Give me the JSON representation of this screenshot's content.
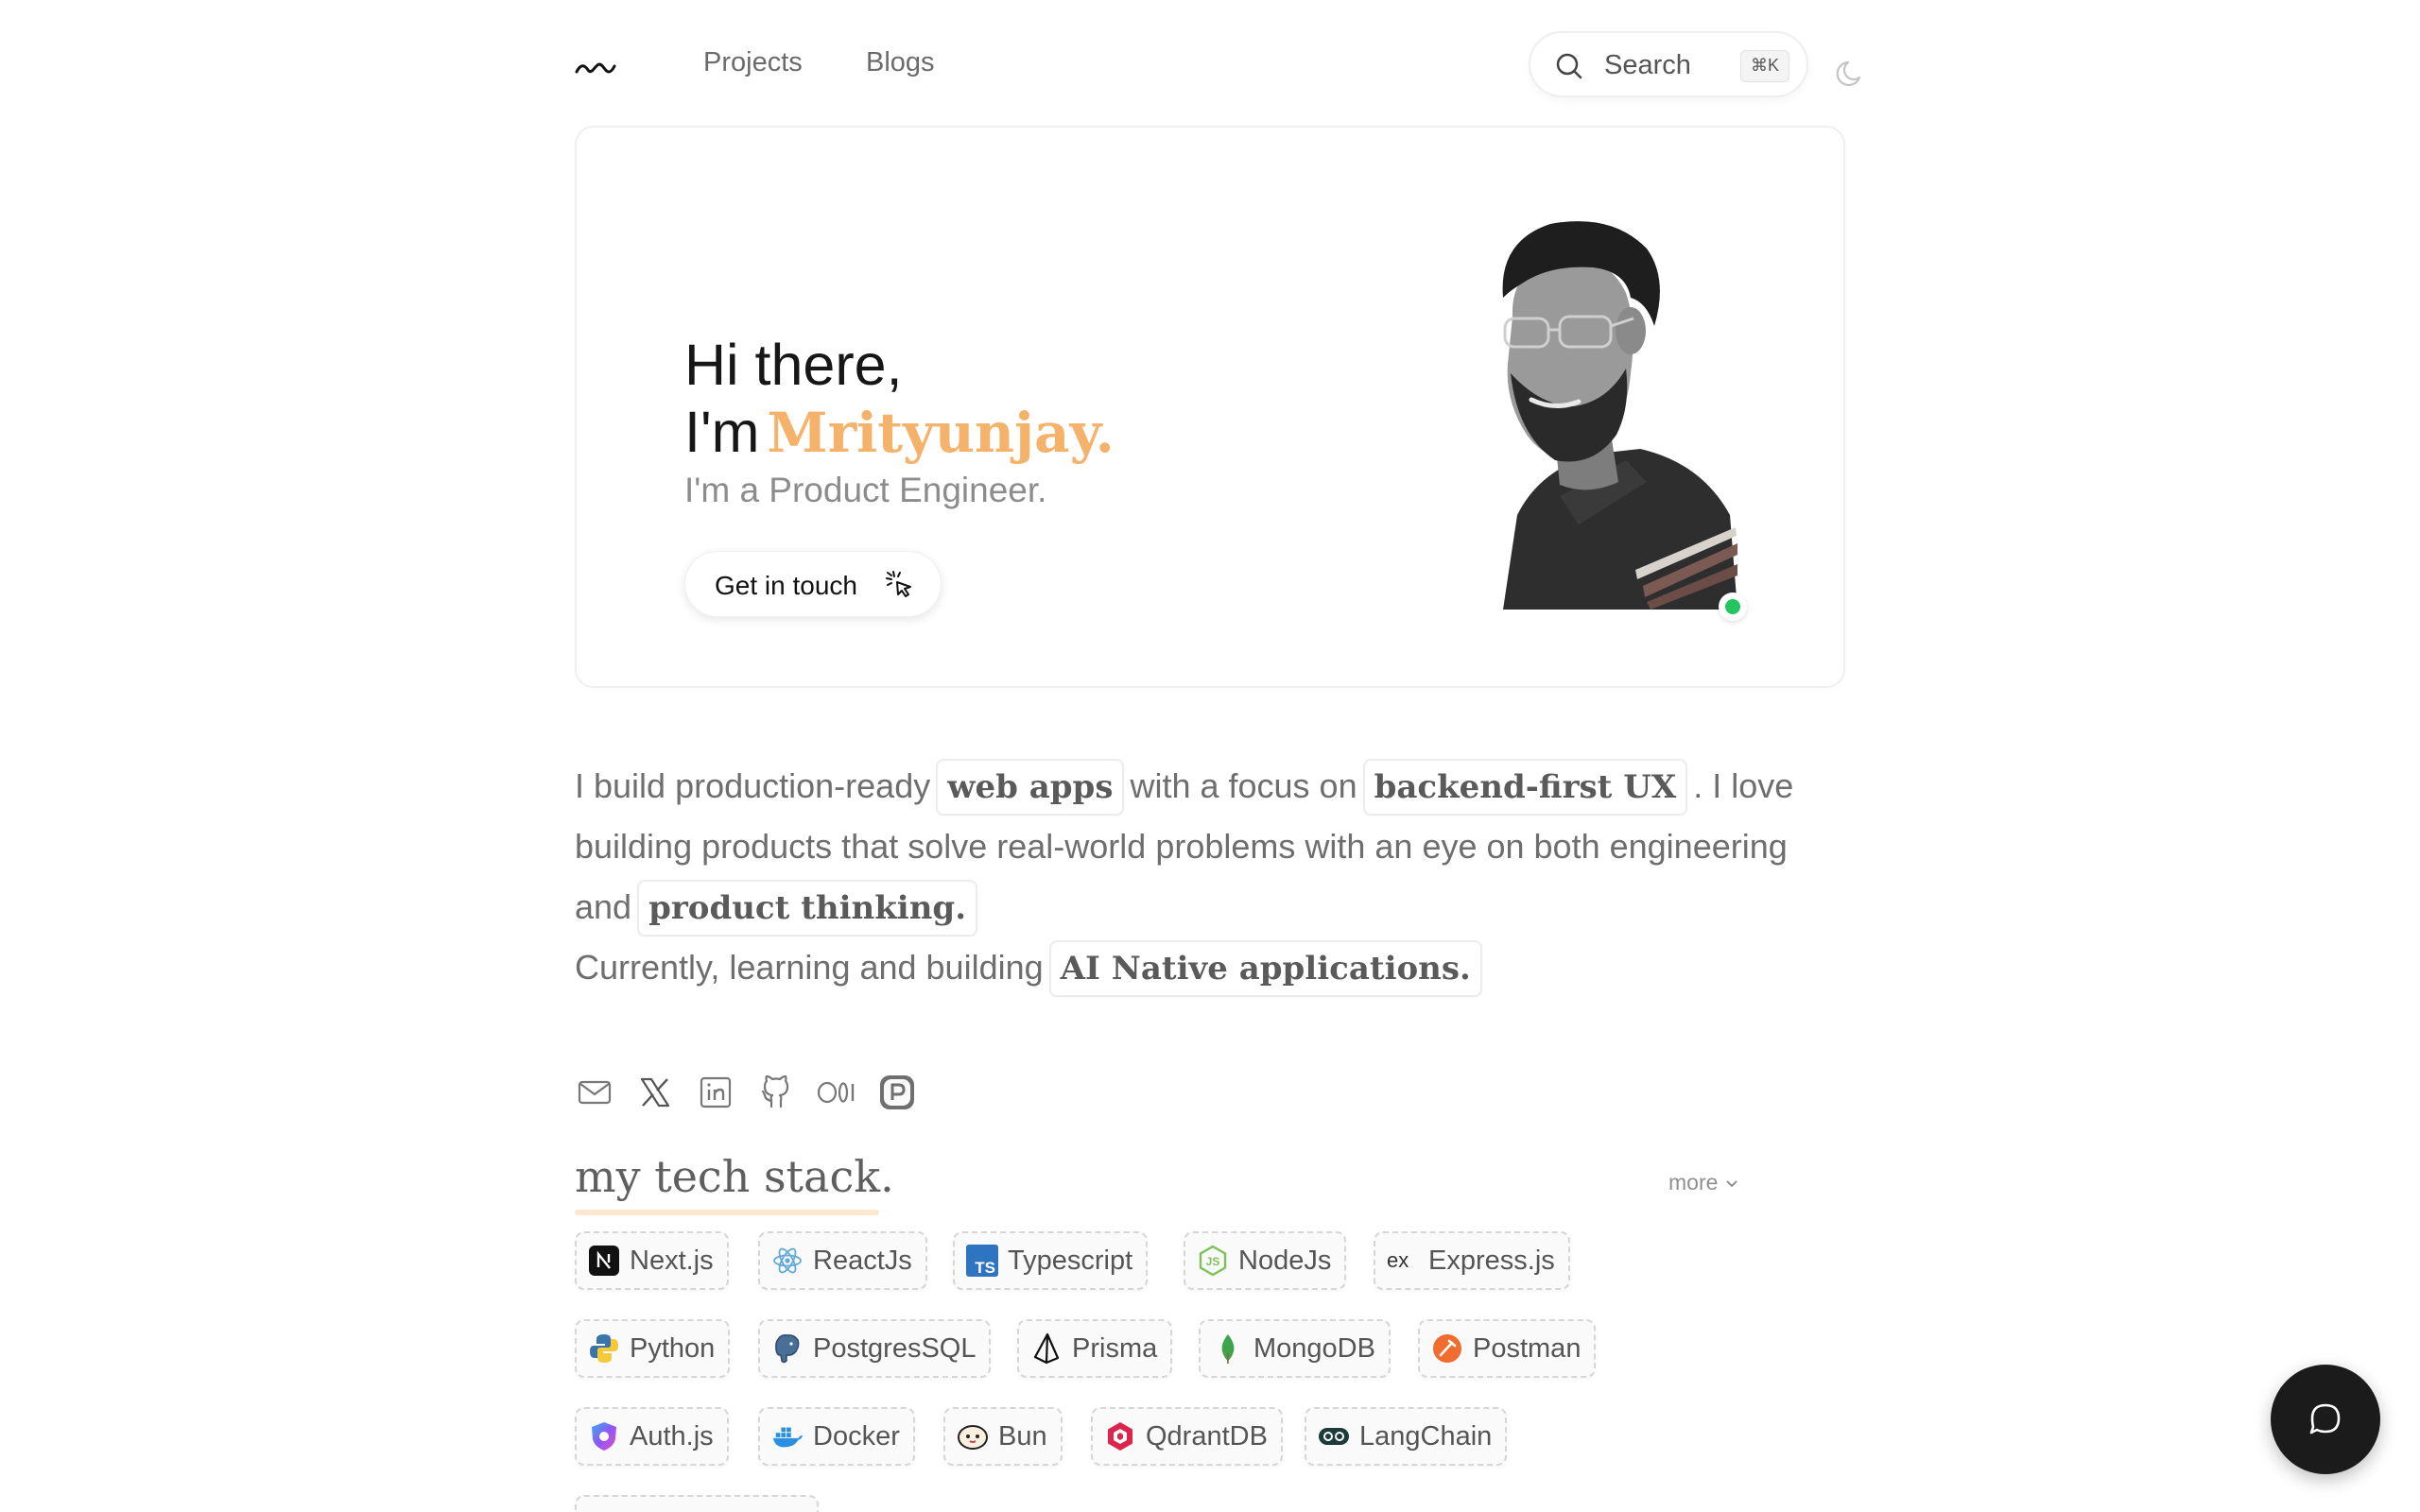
{
  "nav": {
    "links": [
      {
        "label": "Projects"
      },
      {
        "label": "Blogs"
      }
    ],
    "search": {
      "label": "Search",
      "shortcut": "⌘K"
    }
  },
  "hero": {
    "greeting": "Hi there,",
    "im": "I'm",
    "name": "Mrityunjay.",
    "role": "I'm a Product Engineer.",
    "cta": "Get in touch",
    "status_color": "#22c55e",
    "accent_color": "#f5b26b"
  },
  "intro": {
    "p1_a": "I build production-ready",
    "hl1": "web apps",
    "p1_b": "with a focus on",
    "hl2": "backend-first UX",
    "p1_c": ". I love building products that solve real-world problems with an eye on both engineering and",
    "hl3": "product thinking.",
    "p2_a": "Currently, learning and building",
    "hl4": "AI Native applications."
  },
  "socials": [
    "mail-icon",
    "x-icon",
    "linkedin-icon",
    "github-icon",
    "medium-icon",
    "peerlist-icon"
  ],
  "stack": {
    "title": "my tech stack.",
    "more": "more",
    "rows": [
      [
        {
          "label": "Next.js",
          "icon": "nextjs-icon"
        },
        {
          "label": "ReactJs",
          "icon": "react-icon"
        },
        {
          "label": "Typescript",
          "icon": "typescript-icon"
        },
        {
          "label": "NodeJs",
          "icon": "nodejs-icon"
        },
        {
          "label": "Express.js",
          "icon": "express-icon"
        }
      ],
      [
        {
          "label": "Python",
          "icon": "python-icon"
        },
        {
          "label": "PostgresSQL",
          "icon": "postgres-icon"
        },
        {
          "label": "Prisma",
          "icon": "prisma-icon"
        },
        {
          "label": "MongoDB",
          "icon": "mongodb-icon"
        },
        {
          "label": "Postman",
          "icon": "postman-icon"
        }
      ],
      [
        {
          "label": "Auth.js",
          "icon": "authjs-icon"
        },
        {
          "label": "Docker",
          "icon": "docker-icon"
        },
        {
          "label": "Bun",
          "icon": "bun-icon"
        },
        {
          "label": "QdrantDB",
          "icon": "qdrant-icon"
        },
        {
          "label": "LangChain",
          "icon": "langchain-icon"
        }
      ]
    ]
  }
}
